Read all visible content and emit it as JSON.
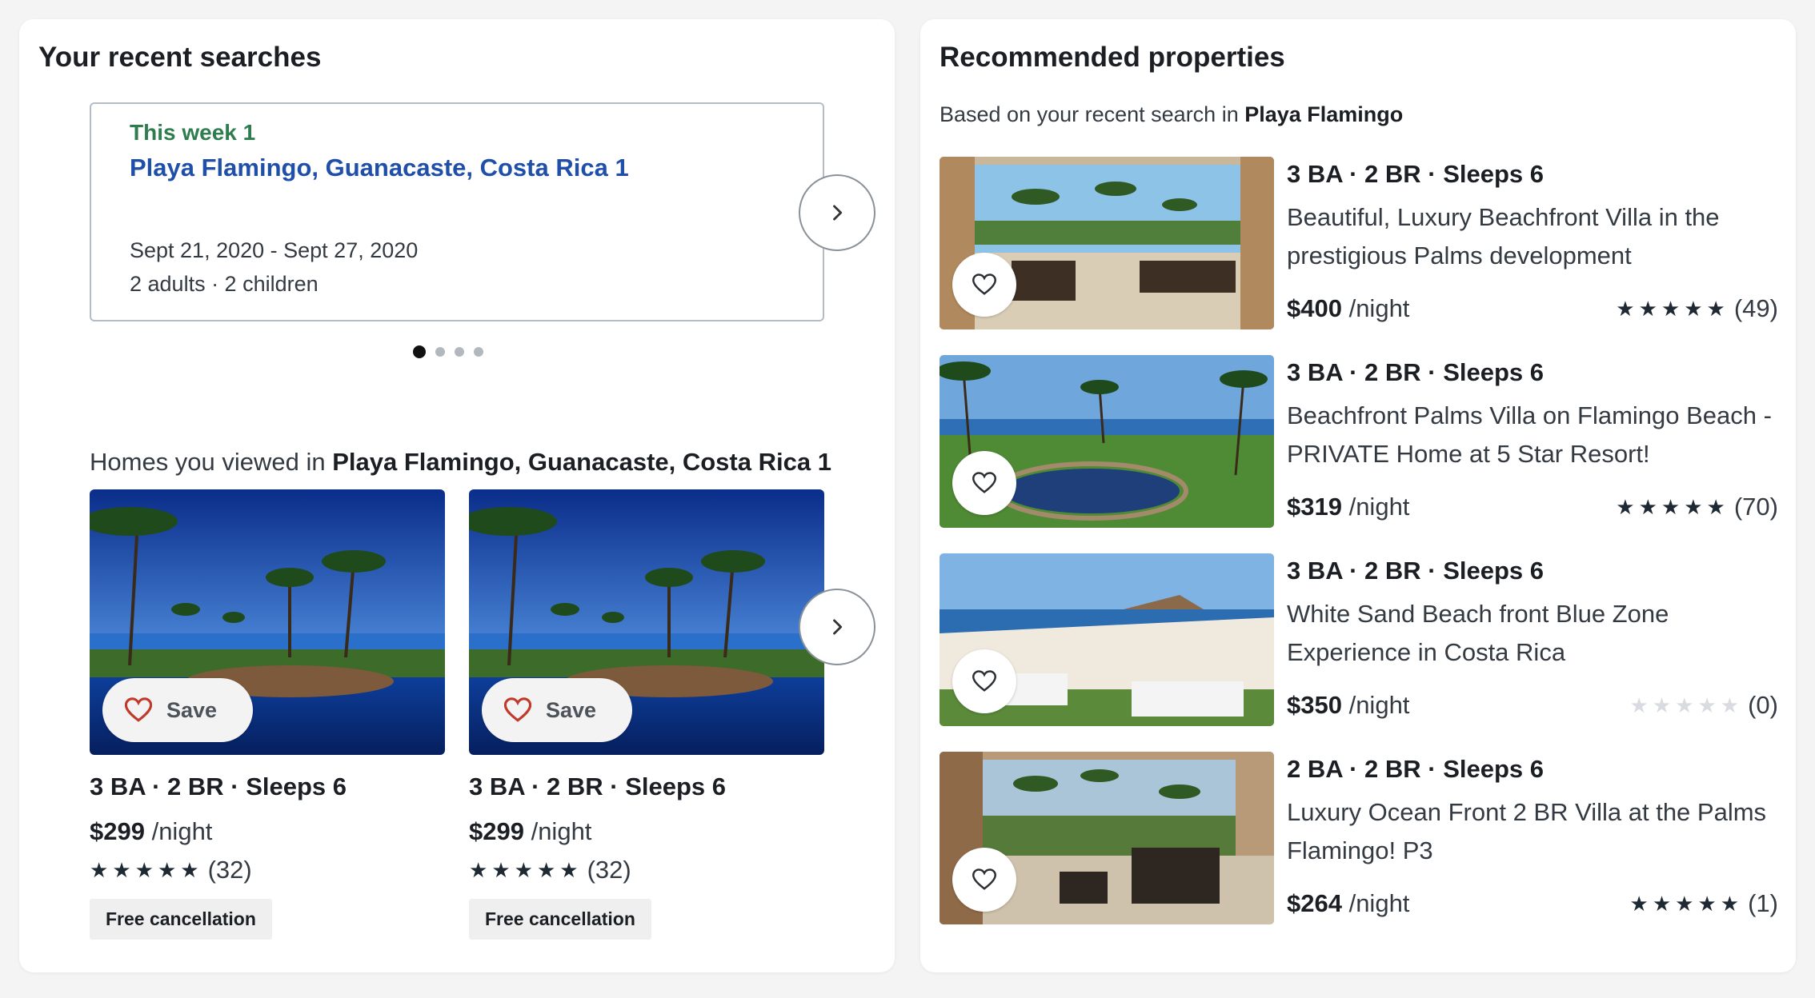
{
  "recent_searches": {
    "title": "Your recent searches",
    "card": {
      "when": "This week 1",
      "place": "Playa Flamingo, Guanacaste, Costa Rica 1",
      "dates": "Sept 21, 2020 - Sept 27, 2020",
      "guests": "2 adults · 2 children"
    },
    "pager": {
      "pages": 4,
      "active": 1
    }
  },
  "homes_viewed": {
    "prefix": "Homes you viewed in ",
    "place": "Playa Flamingo, Guanacaste, Costa Rica 1",
    "items": [
      {
        "save_label": "Save",
        "specs": "3 BA · 2 BR · Sleeps 6",
        "price": "$299",
        "per": " /night",
        "stars": 5,
        "reviews": "(32)",
        "tag": "Free cancellation"
      },
      {
        "save_label": "Save",
        "specs": "3 BA · 2 BR · Sleeps 6",
        "price": "$299",
        "per": " /night",
        "stars": 5,
        "reviews": "(32)",
        "tag": "Free cancellation"
      }
    ]
  },
  "recommended": {
    "title": "Recommended properties",
    "based_prefix": "Based on your recent search in ",
    "based_place": "Playa Flamingo",
    "items": [
      {
        "specs": "3 BA · 2 BR · Sleeps 6",
        "title": "Beautiful, Luxury Beachfront Villa in the prestigious Palms development",
        "price": "$400",
        "per": " /night",
        "stars": 5,
        "reviews": "(49)"
      },
      {
        "specs": "3 BA · 2 BR · Sleeps 6",
        "title": "Beachfront Palms Villa on Flamingo Beach - PRIVATE Home at 5 Star Resort!",
        "price": "$319",
        "per": " /night",
        "stars": 5,
        "reviews": "(70)"
      },
      {
        "specs": "3 BA · 2 BR · Sleeps 6",
        "title": "White Sand Beach front Blue Zone Experience in Costa Rica",
        "price": "$350",
        "per": " /night",
        "stars": 0,
        "reviews": "(0)"
      },
      {
        "specs": "2 BA · 2 BR · Sleeps 6",
        "title": "Luxury Ocean Front 2 BR Villa at the Palms Flamingo! P3",
        "price": "$264",
        "per": " /night",
        "stars": 5,
        "reviews": "(1)"
      }
    ]
  },
  "icons": {
    "next": "chevron-right-icon",
    "heart": "heart-outline-icon",
    "star": "star-icon"
  },
  "colors": {
    "accent_green": "#2e7d4f",
    "link_blue": "#1f4fa8",
    "heart_red": "#c0392b"
  }
}
